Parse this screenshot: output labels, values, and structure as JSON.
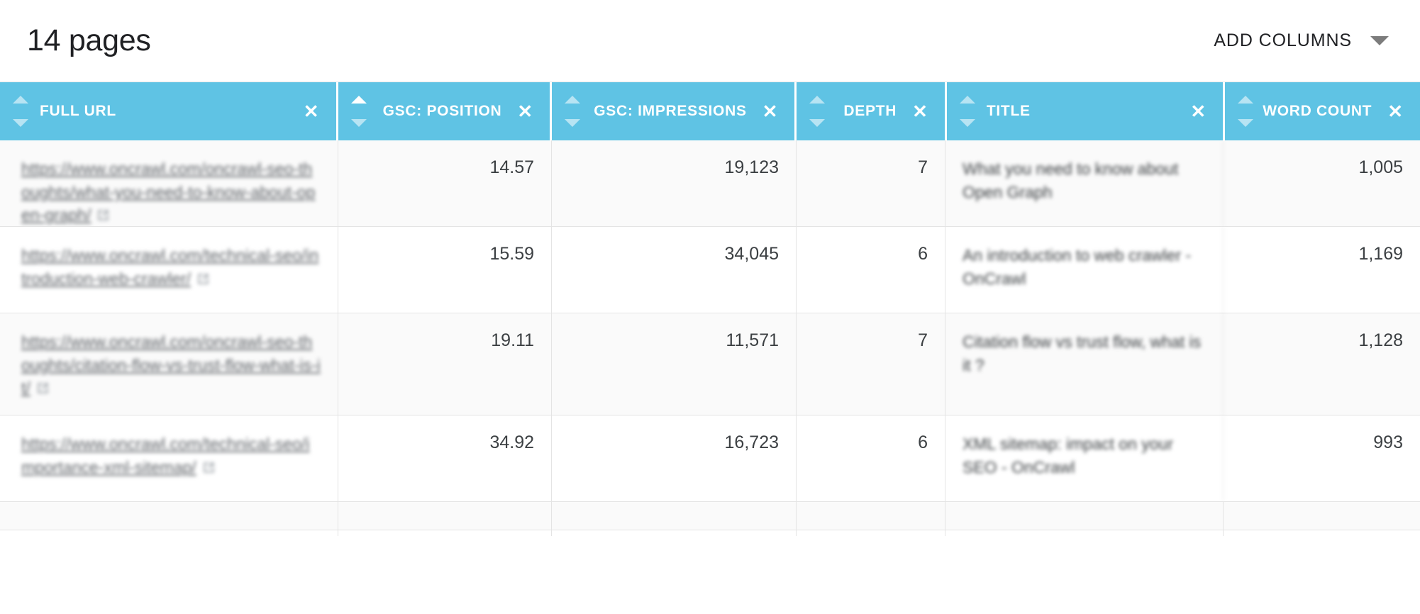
{
  "header": {
    "page_title": "14 pages",
    "add_columns_label": "ADD COLUMNS",
    "caret_icon": "chevron-down-icon"
  },
  "table": {
    "columns": [
      {
        "label": "FULL URL",
        "align": "left",
        "sorted": "none",
        "close_icon": "close-icon"
      },
      {
        "label": "GSC: POSITION",
        "align": "right",
        "sorted": "asc",
        "close_icon": "close-icon"
      },
      {
        "label": "GSC: IMPRESSIONS",
        "align": "right",
        "sorted": "none",
        "close_icon": "close-icon"
      },
      {
        "label": "DEPTH",
        "align": "right",
        "sorted": "none",
        "close_icon": "close-icon"
      },
      {
        "label": "TITLE",
        "align": "left",
        "sorted": "none",
        "close_icon": "close-icon"
      },
      {
        "label": "WORD COUNT",
        "align": "right",
        "sorted": "none",
        "close_icon": "close-icon"
      }
    ],
    "rows": [
      {
        "full_url": "https://www.oncrawl.com/oncrawl-seo-thoughts/what-you-need-to-know-about-open-graph/",
        "gsc_position": "14.57",
        "gsc_impressions": "19,123",
        "depth": "7",
        "title": "What you need to know about Open Graph",
        "word_count": "1,005",
        "external_link_icon": "external-link-icon"
      },
      {
        "full_url": "https://www.oncrawl.com/technical-seo/introduction-web-crawler/",
        "gsc_position": "15.59",
        "gsc_impressions": "34,045",
        "depth": "6",
        "title": "An introduction to web crawler - OnCrawl",
        "word_count": "1,169",
        "external_link_icon": "external-link-icon"
      },
      {
        "full_url": "https://www.oncrawl.com/oncrawl-seo-thoughts/citation-flow-vs-trust-flow-what-is-it/",
        "gsc_position": "19.11",
        "gsc_impressions": "11,571",
        "depth": "7",
        "title": "Citation flow vs trust flow, what is it ?",
        "word_count": "1,128",
        "external_link_icon": "external-link-icon"
      },
      {
        "full_url": "https://www.oncrawl.com/technical-seo/importance-xml-sitemap/",
        "gsc_position": "34.92",
        "gsc_impressions": "16,723",
        "depth": "6",
        "title": "XML sitemap: impact on your SEO - OnCrawl",
        "word_count": "993",
        "external_link_icon": "external-link-icon"
      }
    ]
  },
  "colors": {
    "header_blue": "#5fc3e4",
    "row_alt": "#fafafa",
    "border": "#e4e4e4",
    "text": "#3c4043"
  }
}
